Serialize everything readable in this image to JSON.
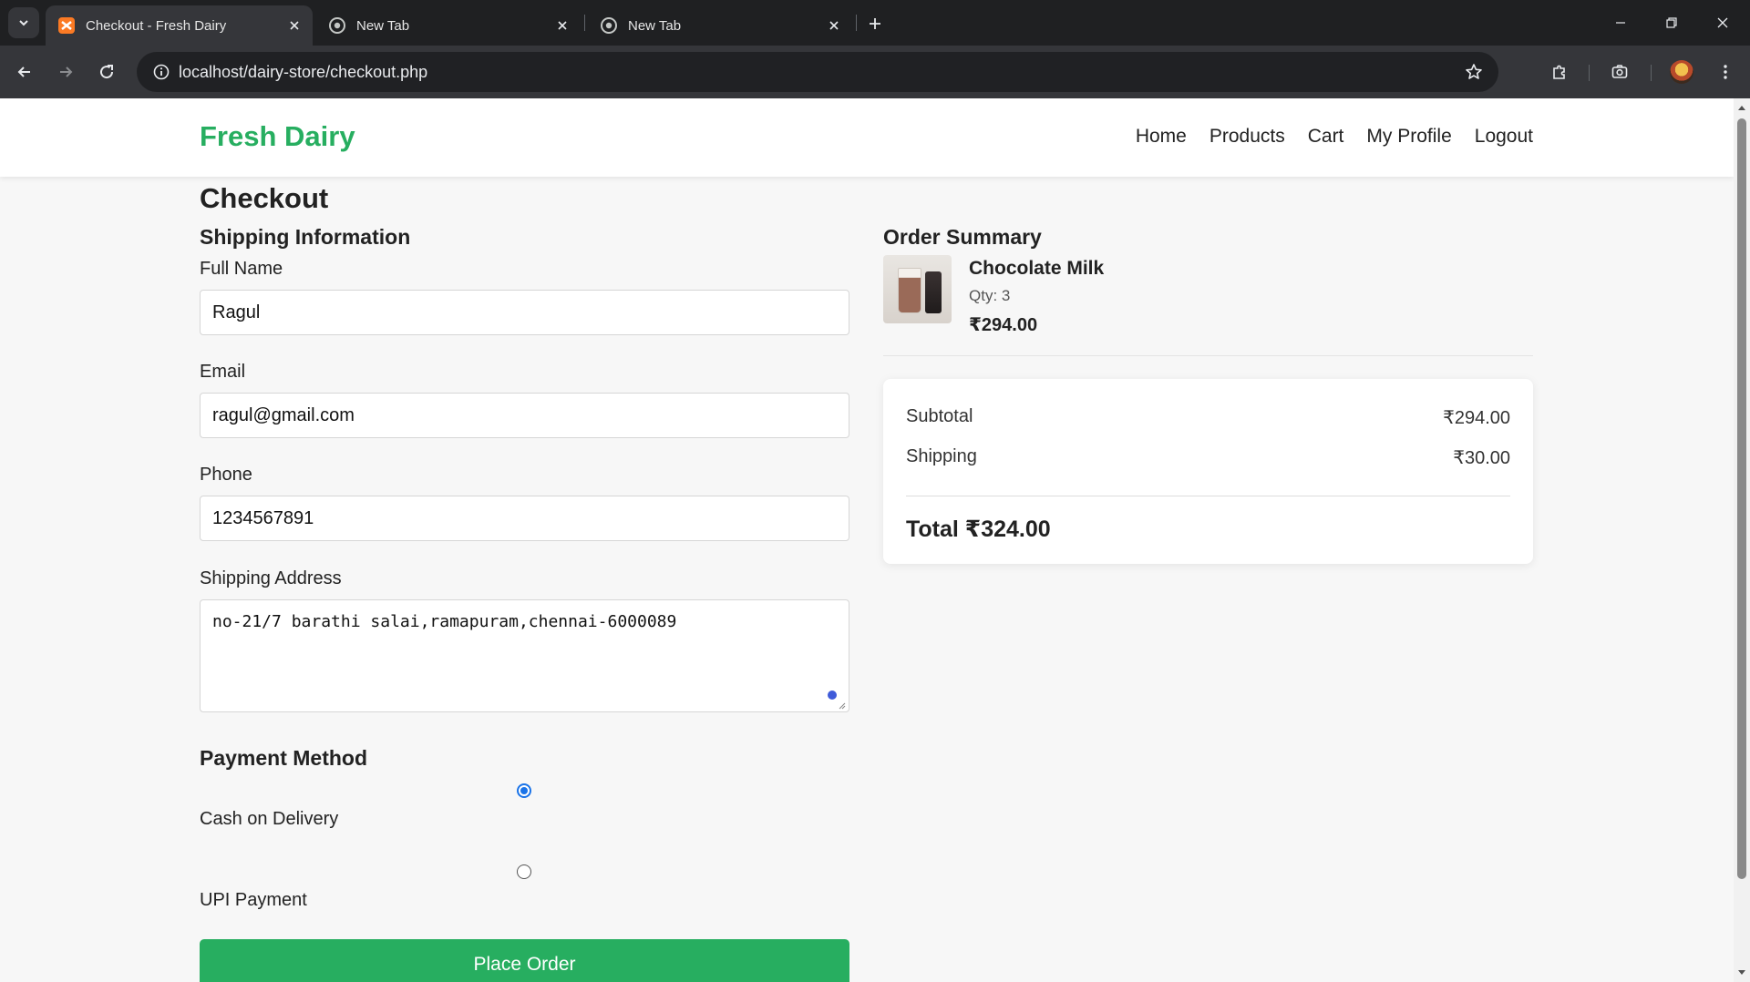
{
  "browser": {
    "tabs": [
      {
        "title": "Checkout - Fresh Dairy",
        "icon": "xampp-favicon",
        "active": true
      },
      {
        "title": "New Tab",
        "icon": "chrome-favicon",
        "active": false
      },
      {
        "title": "New Tab",
        "icon": "chrome-favicon",
        "active": false
      }
    ],
    "url": "localhost/dairy-store/checkout.php"
  },
  "header": {
    "brand": "Fresh Dairy",
    "nav": [
      "Home",
      "Products",
      "Cart",
      "My Profile",
      "Logout"
    ]
  },
  "page": {
    "title": "Checkout"
  },
  "shipping": {
    "heading": "Shipping Information",
    "full_name_label": "Full Name",
    "full_name": "Ragul",
    "email_label": "Email",
    "email": "ragul@gmail.com",
    "phone_label": "Phone",
    "phone": "1234567891",
    "address_label": "Shipping Address",
    "address": "no-21/7 barathi salai,ramapuram,chennai-6000089"
  },
  "payment": {
    "heading": "Payment Method",
    "options": [
      {
        "label": "Cash on Delivery",
        "selected": true
      },
      {
        "label": "UPI Payment",
        "selected": false
      }
    ],
    "submit_label": "Place Order"
  },
  "summary": {
    "heading": "Order Summary",
    "items": [
      {
        "name": "Chocolate Milk",
        "qty": "Qty: 3",
        "price": "₹294.00"
      }
    ],
    "subtotal_label": "Subtotal",
    "subtotal": "₹294.00",
    "shipping_label": "Shipping",
    "shipping": "₹30.00",
    "total": "Total ₹324.00"
  },
  "colors": {
    "brand_green": "#27ae60",
    "radio_blue": "#1a73e8",
    "chrome_dark": "#1f2022",
    "chrome_toolbar": "#35363a"
  }
}
